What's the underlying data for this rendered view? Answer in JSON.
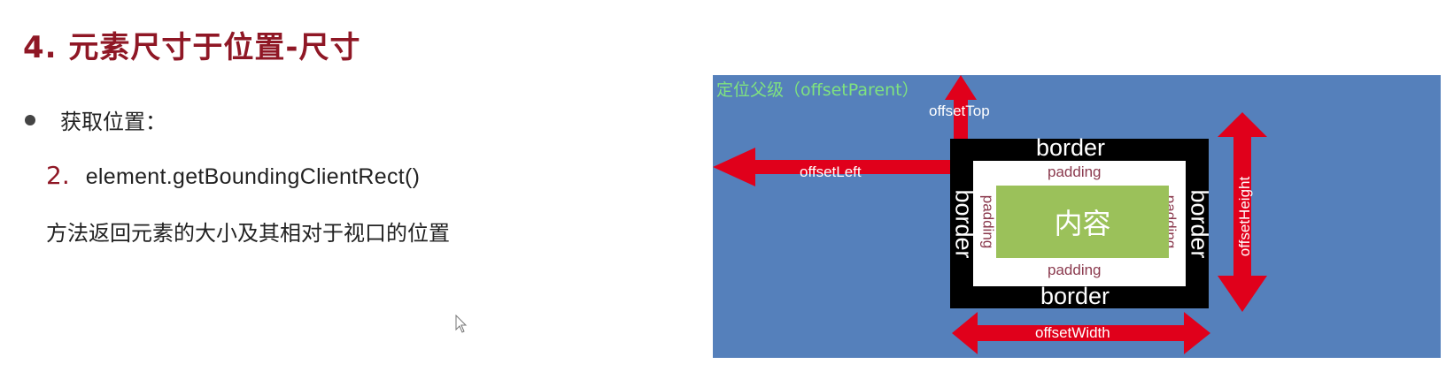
{
  "slide": {
    "title": "4. 元素尺寸于位置-尺寸",
    "bullet": "获取位置：",
    "step_number": "2.",
    "step_text": "element.getBoundingClientRect()",
    "description": "方法返回元素的大小及其相对于视口的位置"
  },
  "diagram": {
    "parent_label": "定位父级（offsetParent）",
    "offset_top": "offsetTop",
    "offset_left": "offsetLeft",
    "offset_height": "offsetHeight",
    "offset_width": "offsetWidth",
    "border_top": "border",
    "border_bottom": "border",
    "border_left": "border",
    "border_right": "border",
    "padding_top": "padding",
    "padding_bottom": "padding",
    "padding_left": "padding",
    "padding_right": "padding",
    "content": "内容",
    "colors": {
      "background": "#5580bb",
      "arrow": "#e0001b",
      "border_box": "#000000",
      "content": "#9bc15a",
      "parent_label": "#7fe27f",
      "title": "#8f1725"
    }
  }
}
